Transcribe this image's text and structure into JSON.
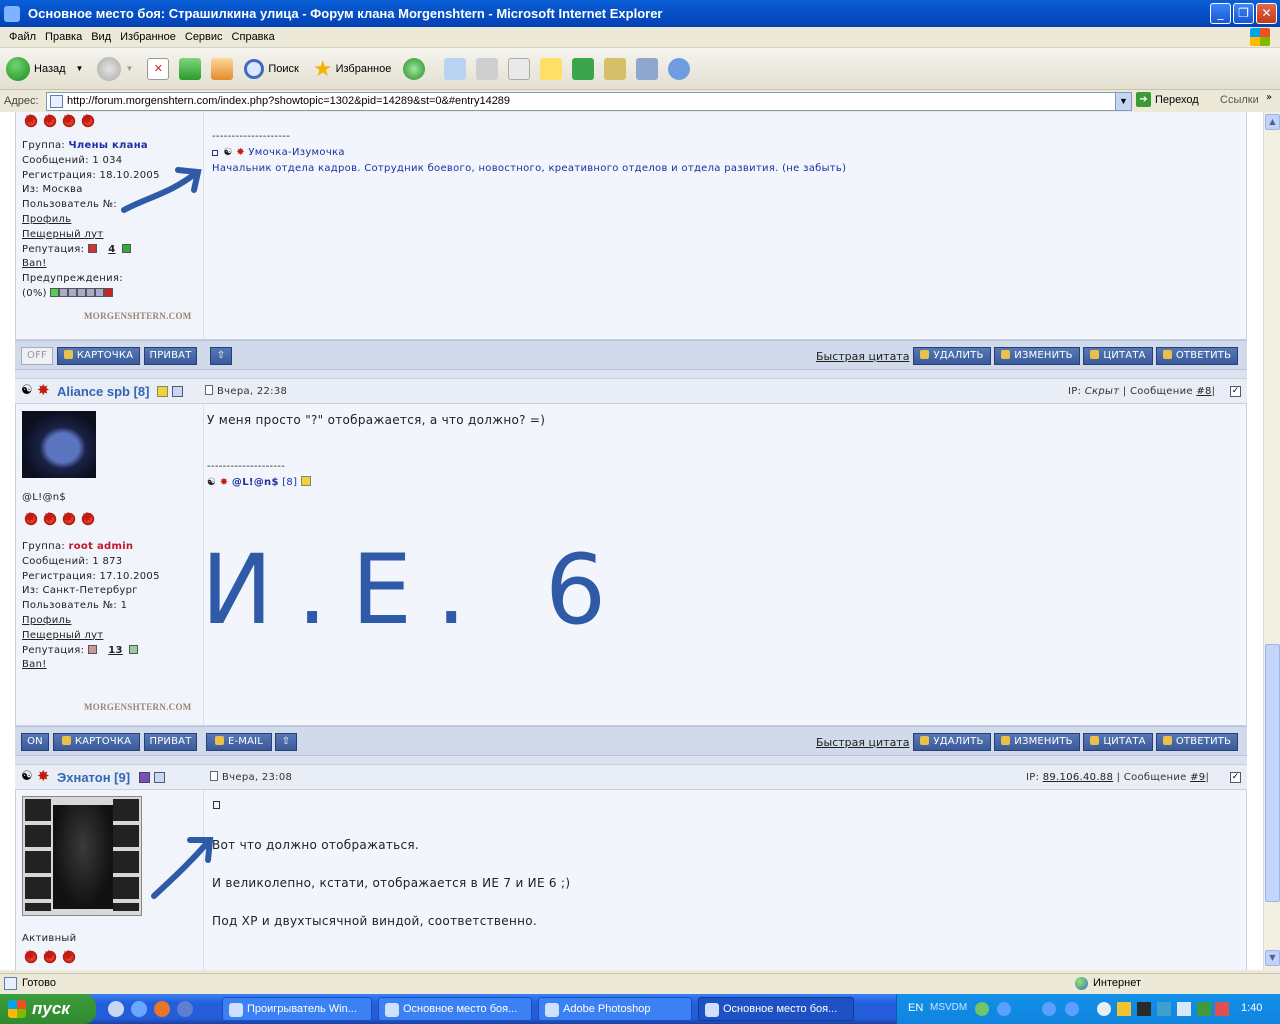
{
  "window": {
    "title": "Основное место боя: Страшилкина улица - Форум клана Morgenshtern - Microsoft Internet Explorer"
  },
  "menu": [
    "Файл",
    "Правка",
    "Вид",
    "Избранное",
    "Сервис",
    "Справка"
  ],
  "toolbar": {
    "back": "Назад",
    "search": "Поиск",
    "favorites": "Избранное"
  },
  "address": {
    "label": "Адрес:",
    "url": "http://forum.morgenshtern.com/index.php?showtopic=1302&pid=14289&st=0&#entry14289",
    "go": "Переход",
    "links": "Ссылки"
  },
  "post1": {
    "group_label": "Группа:",
    "group": "Члены клана",
    "messages": "Сообщений: 1 034",
    "registered": "Регистрация: 18.10.2005",
    "from": "Из: Москва",
    "user_no": "Пользователь №:",
    "profile": "Профиль",
    "loot": "Пещерный лут",
    "rep_label": "Репутация:",
    "rep": "4",
    "ban": "Ban!",
    "warn_label": "Предупреждения:",
    "warn": "(0%)",
    "watermark": "MORGENSHTERN.COM",
    "sig_line": "--------------------",
    "sig_name": "Умочка-Изумочка",
    "sig_text": "Начальник отдела кадров. Сотрудник боевого, новостного, креативного отделов и отдела развития. (не забыть)",
    "btn_status": "OFF"
  },
  "buttons": {
    "card": "КАРТОЧКА",
    "priv": "ПРИВАТ",
    "quick_quote": "Быстрая цитата",
    "delete": "УДАЛИТЬ",
    "edit": "ИЗМЕНИТЬ",
    "quote": "ЦИТАТА",
    "reply": "ОТВЕТИТЬ",
    "email": "E-MAIL"
  },
  "post2": {
    "author": "Aliance spb [8]",
    "date": "Вчера, 22:38",
    "ip_label": "IP:",
    "ip": "Скрыт",
    "msg_label": "Сообщение",
    "msg_no": "#8",
    "nick": "@L!@n$",
    "group_label": "Группа:",
    "group": "root admin",
    "messages": "Сообщений: 1 873",
    "registered": "Регистрация: 17.10.2005",
    "from": "Из: Санкт-Петербург",
    "user_no": "Пользователь №: 1",
    "profile": "Профиль",
    "loot": "Пещерный лут",
    "rep_label": "Репутация:",
    "rep": "13",
    "ban": "Ban!",
    "watermark": "MORGENSHTERN.COM",
    "text": "У меня просто \"?\" отображается, а что должно? =)",
    "sig_line": "--------------------",
    "sig_name": "@L!@n$",
    "sig_level": "[8]",
    "handwriting": "И.Е. 6",
    "btn_status": "ON"
  },
  "post3": {
    "author": "Эхнатон [9]",
    "date": "Вчера, 23:08",
    "ip_label": "IP:",
    "ip": "89.106.40.88",
    "msg_label": "Сообщение",
    "msg_no": "#9",
    "status": "Активный",
    "line1": "Вот что должно отображаться.",
    "line2": "И великолепно, кстати, отображается в ИЕ 7 и ИЕ 6 ;)",
    "line3": "Под ХР и двухтысячной виндой, соответственно."
  },
  "status": {
    "left": "Готово",
    "zone": "Интернет"
  },
  "taskbar": {
    "start": "пуск",
    "tasks": [
      "Проигрыватель Win...",
      "Основное место боя...",
      "Adobe Photoshop",
      "Основное место боя..."
    ],
    "lang": "EN",
    "msvdm": "MSVDM",
    "clock": "1:40"
  },
  "colors": {
    "title_blue": "#0752c9",
    "forum_button": "#3a5a99",
    "username": "#3266b5",
    "root_admin": "#c4162a",
    "member": "#1d2fa3",
    "handwriting": "#2f5aa8"
  }
}
